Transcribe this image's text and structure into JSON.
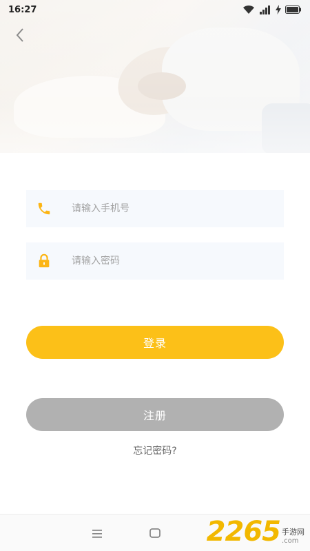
{
  "status_bar": {
    "time": "16:27",
    "icons": [
      "wifi-icon",
      "signal-icon",
      "charging-icon",
      "battery-icon"
    ]
  },
  "header": {
    "back_icon": "chevron-left-icon"
  },
  "form": {
    "phone": {
      "placeholder": "请输入手机号",
      "value": "",
      "icon": "phone-icon"
    },
    "password": {
      "placeholder": "请输入密码",
      "value": "",
      "icon": "lock-icon"
    }
  },
  "actions": {
    "login_label": "登录",
    "register_label": "注册",
    "forgot_label": "忘记密码?"
  },
  "nav": {
    "icons": [
      "menu-icon",
      "home-icon"
    ]
  },
  "watermark": {
    "number": "2265",
    "suffix": ".com",
    "site": "手游网"
  },
  "colors": {
    "accent": "#fcc018",
    "register": "#b1b1b1",
    "field_bg": "#f6f9fd",
    "placeholder": "#a3a3a3"
  }
}
